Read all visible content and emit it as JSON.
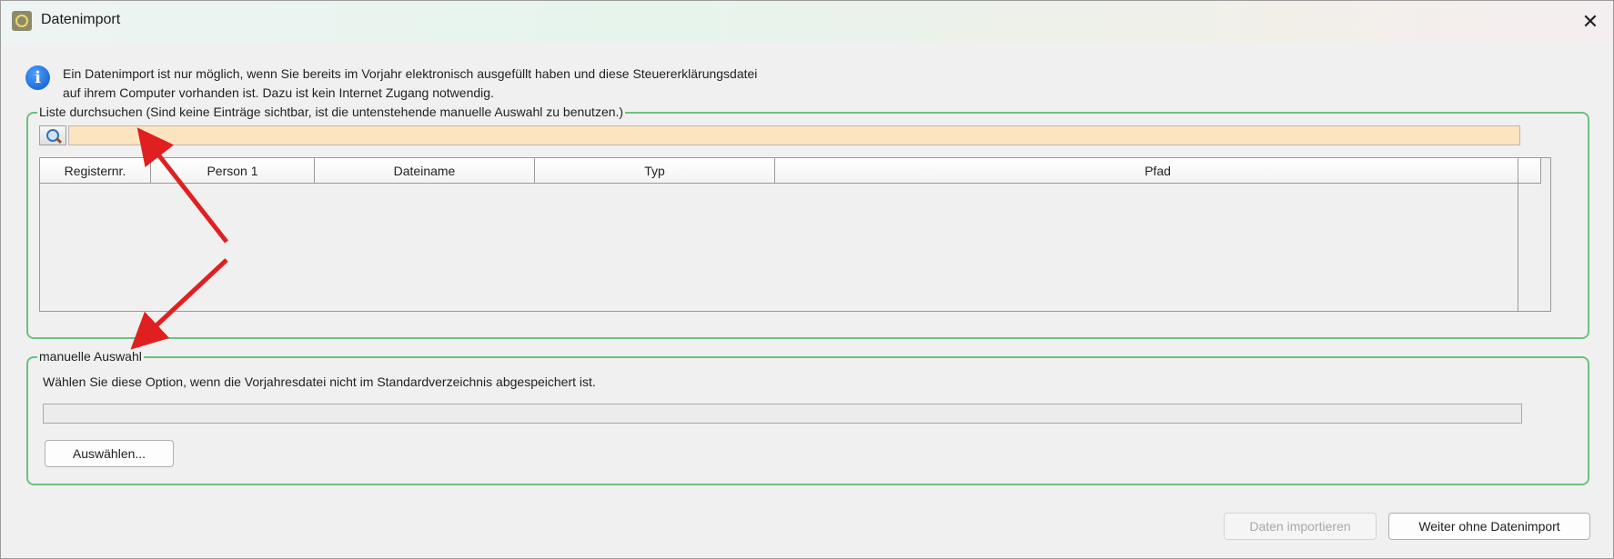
{
  "window": {
    "title": "Datenimport",
    "close_glyph": "✕"
  },
  "info": {
    "icon": "info-icon",
    "line1": "Ein Datenimport ist nur möglich, wenn Sie bereits im Vorjahr elektronisch ausgefüllt haben und diese Steuererklärungsdatei",
    "line2": "auf ihrem Computer vorhanden ist. Dazu ist kein Internet Zugang notwendig."
  },
  "list_group": {
    "legend": "Liste durchsuchen (Sind keine Einträge sichtbar, ist die untenstehende manuelle Auswahl zu benutzen.)",
    "search": {
      "icon": "search-icon",
      "value": "",
      "background": "#fde4c0"
    },
    "columns": [
      "Registernr.",
      "Person 1",
      "Dateiname",
      "Typ",
      "Pfad"
    ],
    "rows": []
  },
  "manual_group": {
    "legend": "manuelle Auswahl",
    "description": "Wählen Sie diese Option, wenn die Vorjahresdatei nicht im Standardverzeichnis abgespeichert ist.",
    "path_value": "",
    "select_button": "Auswählen..."
  },
  "footer": {
    "import_button": "Daten importieren",
    "import_enabled": false,
    "skip_button": "Weiter ohne Datenimport"
  },
  "annotations": {
    "arrow_color": "#e02020"
  }
}
